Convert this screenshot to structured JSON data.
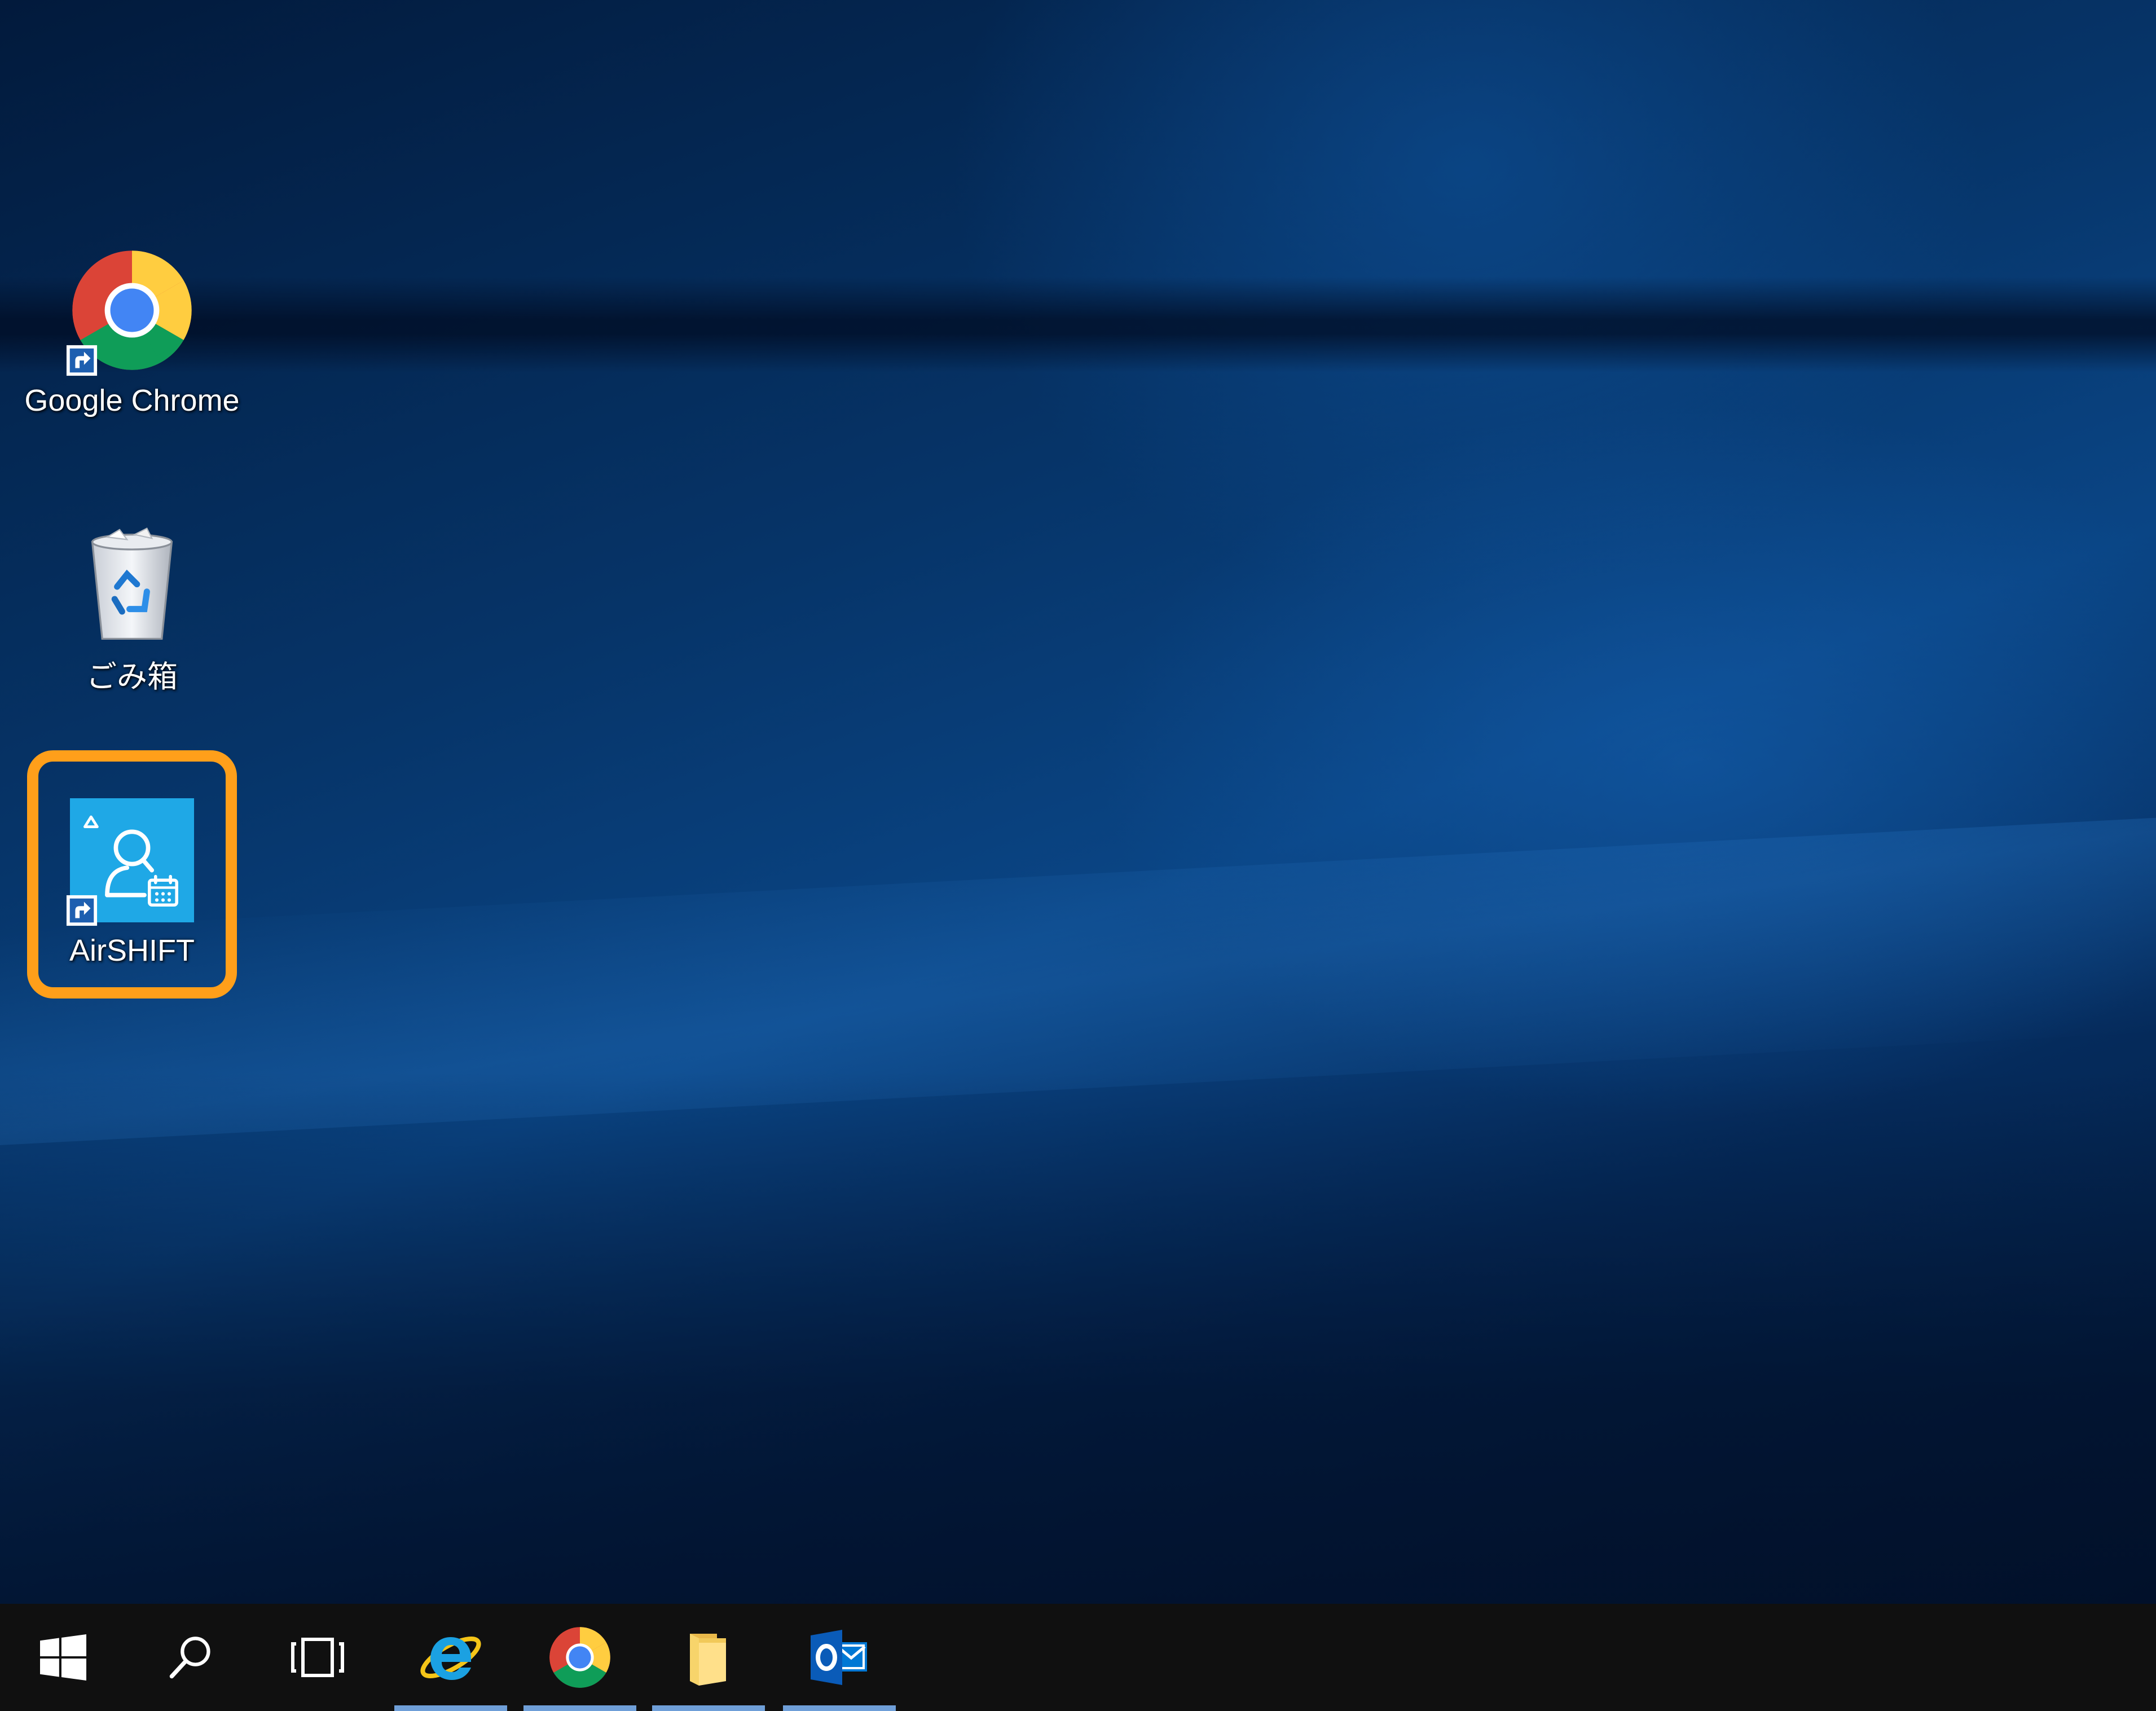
{
  "desktop": {
    "icons": [
      {
        "label": "Google Chrome",
        "icon": "chrome-icon"
      },
      {
        "label": "ごみ箱",
        "icon": "recycle-bin-icon"
      },
      {
        "label": "AirSHIFT",
        "icon": "airshift-icon",
        "highlighted": true
      }
    ],
    "highlight_color": "#ff9f1a"
  },
  "taskbar": {
    "items": [
      {
        "name": "start",
        "icon": "windows-logo-icon"
      },
      {
        "name": "search",
        "icon": "search-icon"
      },
      {
        "name": "task-view",
        "icon": "task-view-icon"
      },
      {
        "name": "internet-explorer",
        "icon": "internet-explorer-icon",
        "pinned_active": true
      },
      {
        "name": "google-chrome",
        "icon": "chrome-icon",
        "pinned_active": true
      },
      {
        "name": "file-explorer",
        "icon": "folder-icon",
        "pinned_active": true
      },
      {
        "name": "outlook",
        "icon": "outlook-icon",
        "pinned_active": true
      }
    ]
  },
  "colors": {
    "taskbar_bg": "#101010",
    "active_indicator": "#6f9fd8",
    "airshift_tile": "#1fa8e6"
  }
}
